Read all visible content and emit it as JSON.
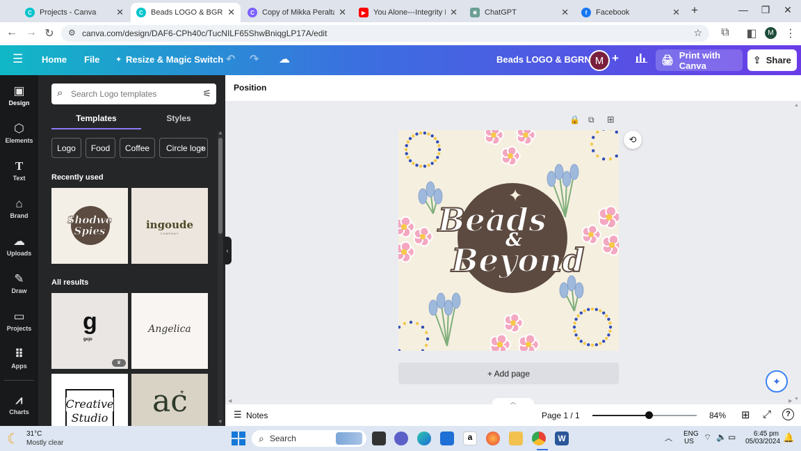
{
  "browser": {
    "tabs": [
      {
        "title": "Projects - Canva",
        "color": "#00c4cc"
      },
      {
        "title": "Beads LOGO & BGRND - L",
        "color": "#00c4cc"
      },
      {
        "title": "Copy of Mikka Peralta_TEA",
        "color": "#7b61ff"
      },
      {
        "title": "You Alone---Integrity Mus",
        "color": "#ff0000"
      },
      {
        "title": "ChatGPT",
        "color": "#6b9e94"
      },
      {
        "title": "Facebook",
        "color": "#1877f2"
      }
    ],
    "new_tab_label": "+",
    "url": "canva.com/design/DAF6-CPh40c/TucNILF65ShwBniqgLP17A/edit",
    "profile_initial": "M"
  },
  "header": {
    "home_label": "Home",
    "file_label": "File",
    "resize_label": "Resize & Magic Switch",
    "design_title": "Beads LOGO & BGRND",
    "avatar_initial": "M",
    "print_label": "Print with Canva",
    "share_label": "Share"
  },
  "rail": {
    "items": [
      {
        "label": "Design",
        "icon": "design-icon"
      },
      {
        "label": "Elements",
        "icon": "elements-icon"
      },
      {
        "label": "Text",
        "icon": "text-icon"
      },
      {
        "label": "Brand",
        "icon": "brand-icon"
      },
      {
        "label": "Uploads",
        "icon": "uploads-icon"
      },
      {
        "label": "Draw",
        "icon": "draw-icon"
      },
      {
        "label": "Projects",
        "icon": "projects-icon"
      },
      {
        "label": "Apps",
        "icon": "apps-icon"
      },
      {
        "label": "Charts",
        "icon": "charts-icon"
      }
    ]
  },
  "panel": {
    "search_placeholder": "Search Logo templates",
    "tab_templates": "Templates",
    "tab_styles": "Styles",
    "chips": [
      "Logo",
      "Food",
      "Coffee",
      "Circle logo"
    ],
    "recently_used": "Recently used",
    "all_results": "All results",
    "thumb1_line1": "Shodwe",
    "thumb1_line2": "Spies",
    "thumb2_text": "ingoude",
    "thumb2_sub": "COMPANY",
    "thumb3_text": "gojo",
    "thumb4_text": "Angelica",
    "thumb5_line1": "Creative",
    "thumb5_line2": "Studio",
    "thumb6_text": "ac"
  },
  "canvas": {
    "toolbar_label": "Position",
    "logo_line1": "Beads",
    "logo_amp": "&",
    "logo_line2": "Beyond",
    "add_page_label": "+ Add page",
    "notes_label": "Notes",
    "page_indicator": "Page 1 / 1",
    "zoom_label": "84%",
    "zoom_value": 0.54,
    "colors": {
      "background": "#f5efe0",
      "circle": "#5c4a40",
      "flower": "#f4a7c0",
      "flower_center": "#f7c948",
      "tulip": "#9fb9dc",
      "stem": "#7fae7a",
      "bead_blue": "#2f4cb5",
      "bead_yellow": "#f2c94c"
    }
  },
  "taskbar": {
    "temperature": "31°C",
    "weather": "Mostly clear",
    "search_label": "Search",
    "lang_line1": "ENG",
    "lang_line2": "US",
    "time": "6:45 pm",
    "date": "05/03/2024"
  }
}
